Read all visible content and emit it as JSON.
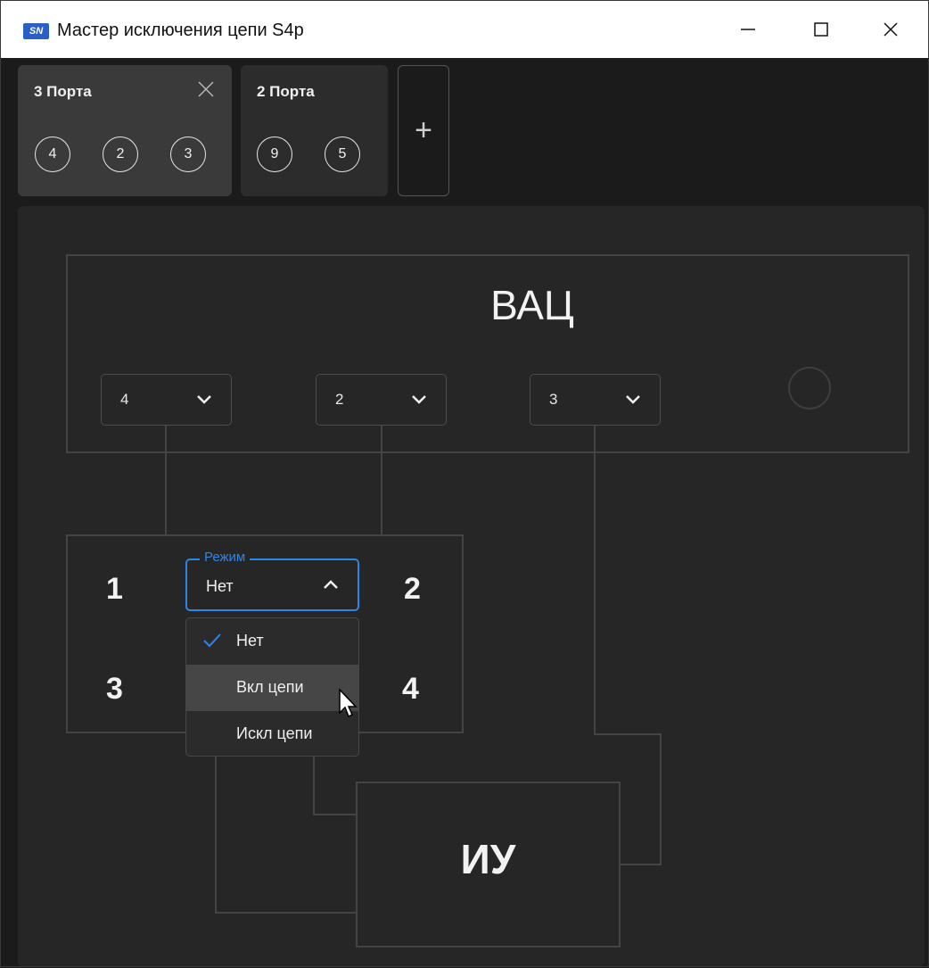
{
  "window": {
    "logo_text": "SN",
    "title": "Мастер исключения цепи S4p",
    "minimize_glyph": "—",
    "maximize_glyph": "☐",
    "close_glyph": "✕"
  },
  "tabs": [
    {
      "label": "3 Порта",
      "ports": [
        "4",
        "2",
        "3"
      ],
      "active": true,
      "close_glyph": "✕"
    },
    {
      "label": "2 Порта",
      "ports": [
        "9",
        "5"
      ],
      "active": false
    }
  ],
  "add_tab_glyph": "+",
  "vna": {
    "title": "ВАЦ",
    "port_selects": [
      "4",
      "2",
      "3"
    ]
  },
  "fixture": {
    "ports": [
      "1",
      "2",
      "3",
      "4"
    ],
    "mode": {
      "legend": "Режим",
      "value": "Нет",
      "options": [
        "Нет",
        "Вкл цепи",
        "Искл цепи"
      ],
      "selected_index": 0,
      "hovered_index": 1
    }
  },
  "dut": {
    "title": "ИУ"
  },
  "colors": {
    "accent": "#2d86e6",
    "background": "#1b1b1b",
    "panel": "#262626",
    "line": "#444444"
  },
  "icons": [
    "close-icon",
    "plus-icon",
    "chevron-down-icon",
    "chevron-up-icon",
    "check-icon",
    "mouse-cursor-icon"
  ]
}
